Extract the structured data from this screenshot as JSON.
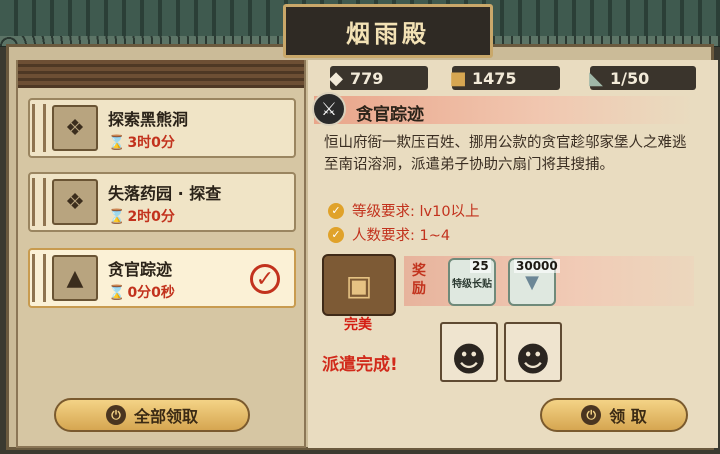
{
  "window": {
    "title": "烟雨殿"
  },
  "resources": [
    {
      "icon": "silver-ore-icon",
      "value": "779"
    },
    {
      "icon": "crates-icon",
      "value": "1475"
    },
    {
      "icon": "boot-icon",
      "value": "1/50"
    }
  ],
  "quests": [
    {
      "name": "探索黑熊洞",
      "time": "3时0分",
      "icon": "map-scroll-icon",
      "selected": false,
      "completed": false
    },
    {
      "name": "失落药园 · 探查",
      "time": "2时0分",
      "icon": "map-scroll-icon",
      "selected": false,
      "completed": false
    },
    {
      "name": "贪官踪迹",
      "time": "0分0秒",
      "icon": "mountain-map-icon",
      "selected": true,
      "completed": true
    }
  ],
  "buttons": {
    "claim_all": "全部领取",
    "claim": "领 取"
  },
  "detail": {
    "title": "贪官踪迹",
    "description": "恒山府衙一欺压百姓、挪用公款的贪官趁邬家堡人之难逃至南诏溶洞，派遣弟子协助六扇门将其搜捕。",
    "requirements": [
      {
        "label": "等级要求: lv10以上"
      },
      {
        "label": "人数要求: 1~4"
      }
    ],
    "reward_label": "奖励",
    "rewards": [
      {
        "name": "特级长贴",
        "count": "25",
        "icon": "token-icon"
      },
      {
        "name": "silver",
        "count": "30000",
        "icon": "silver-ingot-icon"
      }
    ],
    "rating": "完美",
    "status": "派遣完成!"
  },
  "colors": {
    "accent_red": "#c2321d",
    "gold_button": "#e6bd6b",
    "panel": "#e9dcc0"
  }
}
